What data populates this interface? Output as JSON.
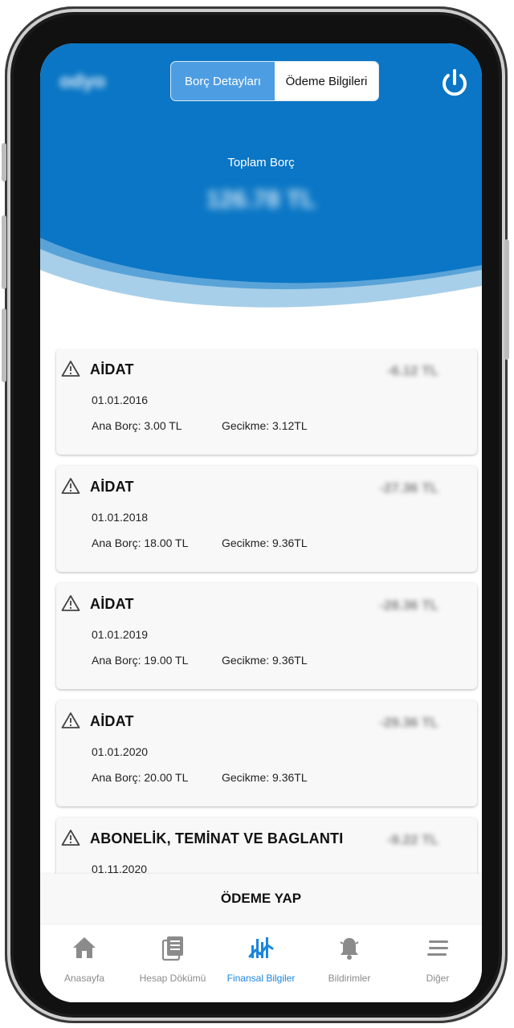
{
  "header": {
    "logo_text": "odyo",
    "tabs": [
      {
        "label": "Borç Detayları",
        "active": true
      },
      {
        "label": "Ödeme Bilgileri",
        "active": false
      }
    ],
    "power_icon": "power-icon"
  },
  "summary": {
    "label": "Toplam Borç",
    "amount": "126.78 TL"
  },
  "debts": [
    {
      "title": "AİDAT",
      "amount": "-6.12 TL",
      "date": "01.01.2016",
      "main": "Ana Borç: 3.00 TL",
      "late": "Gecikme: 3.12TL"
    },
    {
      "title": "AİDAT",
      "amount": "-27.36 TL",
      "date": "01.01.2018",
      "main": "Ana Borç: 18.00 TL",
      "late": "Gecikme: 9.36TL"
    },
    {
      "title": "AİDAT",
      "amount": "-28.36 TL",
      "date": "01.01.2019",
      "main": "Ana Borç: 19.00 TL",
      "late": "Gecikme: 9.36TL"
    },
    {
      "title": "AİDAT",
      "amount": "-29.36 TL",
      "date": "01.01.2020",
      "main": "Ana Borç: 20.00 TL",
      "late": "Gecikme: 9.36TL"
    },
    {
      "title": "ABONELİK, TEMİNAT VE BAGLANTI",
      "amount": "-9.22 TL",
      "date": "01.11.2020",
      "main": "",
      "late": ""
    }
  ],
  "pay_button": "ÖDEME YAP",
  "nav": [
    {
      "label": "Anasayfa",
      "icon": "home-icon",
      "active": false
    },
    {
      "label": "Hesap Dökümü",
      "icon": "document-list-icon",
      "active": false
    },
    {
      "label": "Finansal Bilgiler",
      "icon": "chart-icon",
      "active": true
    },
    {
      "label": "Bildirimler",
      "icon": "bell-icon",
      "active": false
    },
    {
      "label": "Diğer",
      "icon": "menu-icon",
      "active": false
    }
  ],
  "colors": {
    "primary": "#0a76c5",
    "segment_active": "#4d9de3",
    "nav_active": "#1a86df",
    "nav_inactive": "#8b8b8b"
  }
}
